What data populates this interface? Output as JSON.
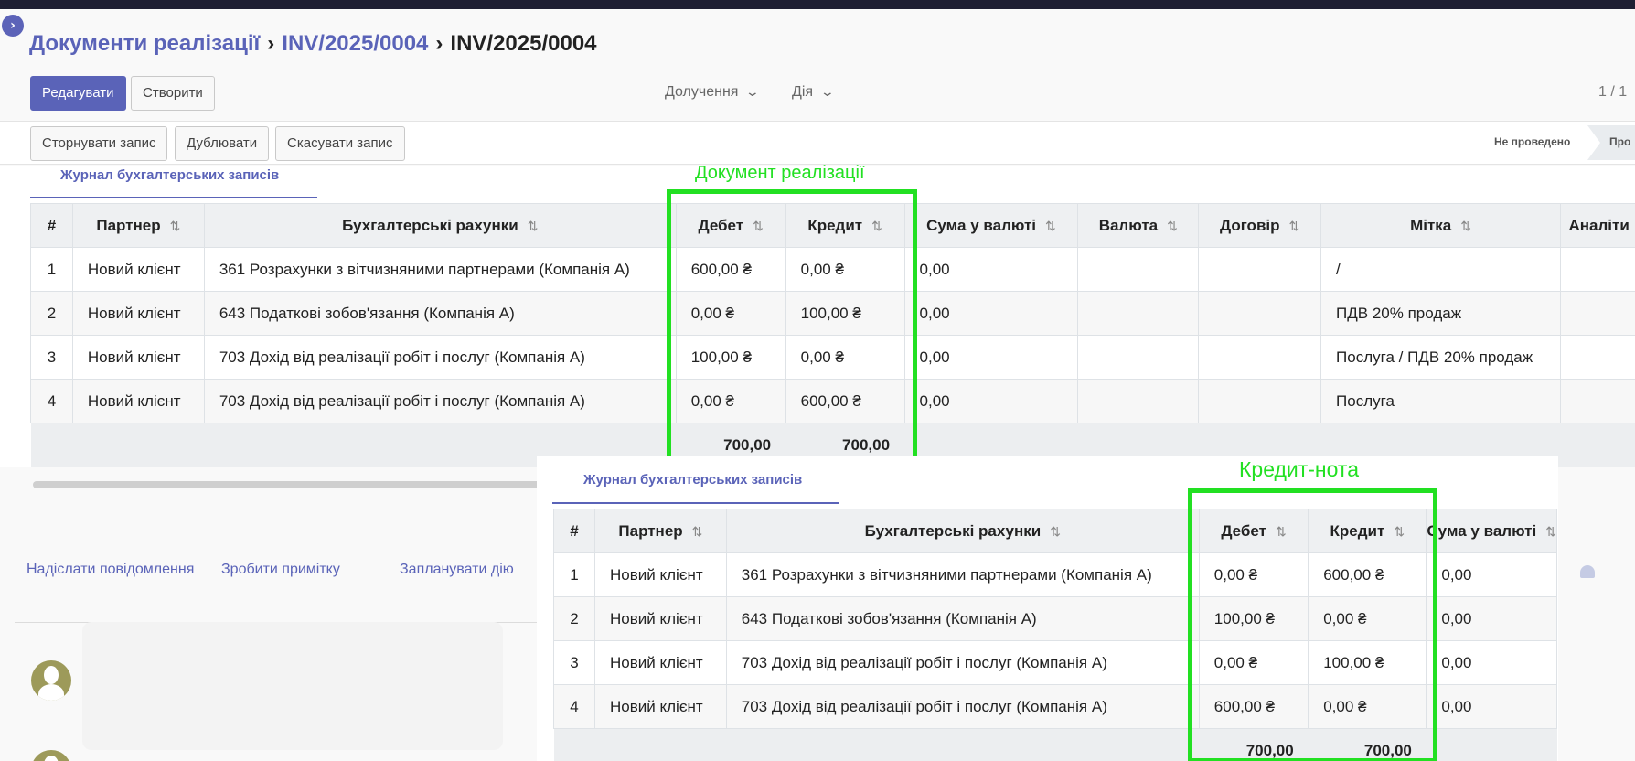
{
  "breadcrumb": {
    "root": "Документи реалізації",
    "parent": "INV/2025/0004",
    "current": "INV/2025/0004"
  },
  "toolbar": {
    "edit_label": "Редагувати",
    "create_label": "Створити"
  },
  "dropdowns": {
    "attach_label": "Долучення",
    "action_label": "Дія"
  },
  "pager": "1 / 1",
  "actions": {
    "reverse_label": "Сторнувати запис",
    "duplicate_label": "Дублювати",
    "cancel_label": "Скасувати запис"
  },
  "statusbar": {
    "current": "Не проведено",
    "next_partial": "Про"
  },
  "annotations": {
    "top": "Документ реалізації",
    "bottom": "Кредит-нота"
  },
  "tables": {
    "top": {
      "tab": "Журнал бухгалтерських записів",
      "headers": [
        "#",
        "Партнер",
        "Бухгалтерські рахунки",
        "Дебет",
        "Кредит",
        "Сума у валюті",
        "Валюта",
        "Договір",
        "Мітка",
        "Аналіти"
      ],
      "rows": [
        [
          "1",
          "Новий клієнт",
          "361 Розрахунки з вітчизняними партнерами (Компанія А)",
          "600,00 ₴",
          "0,00 ₴",
          "0,00",
          "",
          "",
          "/",
          ""
        ],
        [
          "2",
          "Новий клієнт",
          "643 Податкові зобов'язання (Компанія А)",
          "0,00 ₴",
          "100,00 ₴",
          "0,00",
          "",
          "",
          "ПДВ 20% продаж",
          ""
        ],
        [
          "3",
          "Новий клієнт",
          "703 Дохід від реалізації робіт і послуг (Компанія А)",
          "100,00 ₴",
          "0,00 ₴",
          "0,00",
          "",
          "",
          "Послуга / ПДВ 20% продаж",
          ""
        ],
        [
          "4",
          "Новий клієнт",
          "703 Дохід від реалізації робіт і послуг (Компанія А)",
          "0,00 ₴",
          "600,00 ₴",
          "0,00",
          "",
          "",
          "Послуга",
          ""
        ]
      ],
      "totals": {
        "debit": "700,00",
        "credit": "700,00"
      }
    },
    "bottom": {
      "tab": "Журнал бухгалтерських записів",
      "headers": [
        "#",
        "Партнер",
        "Бухгалтерські рахунки",
        "Дебет",
        "Кредит",
        "Сума у валюті"
      ],
      "rows": [
        [
          "1",
          "Новий клієнт",
          "361 Розрахунки з вітчизняними партнерами (Компанія А)",
          "0,00 ₴",
          "600,00 ₴",
          "0,00"
        ],
        [
          "2",
          "Новий клієнт",
          "643 Податкові зобов'язання (Компанія А)",
          "100,00 ₴",
          "0,00 ₴",
          "0,00"
        ],
        [
          "3",
          "Новий клієнт",
          "703 Дохід від реалізації робіт і послуг (Компанія А)",
          "0,00 ₴",
          "100,00 ₴",
          "0,00"
        ],
        [
          "4",
          "Новий клієнт",
          "703 Дохід від реалізації робіт і послуг (Компанія А)",
          "600,00 ₴",
          "0,00 ₴",
          "0,00"
        ]
      ],
      "totals": {
        "debit": "700,00",
        "credit": "700,00"
      }
    }
  },
  "chatter": {
    "send_message": "Надіслати повідомлення",
    "log_note": "Зробити примітку",
    "schedule_activity": "Запланувати дію"
  }
}
